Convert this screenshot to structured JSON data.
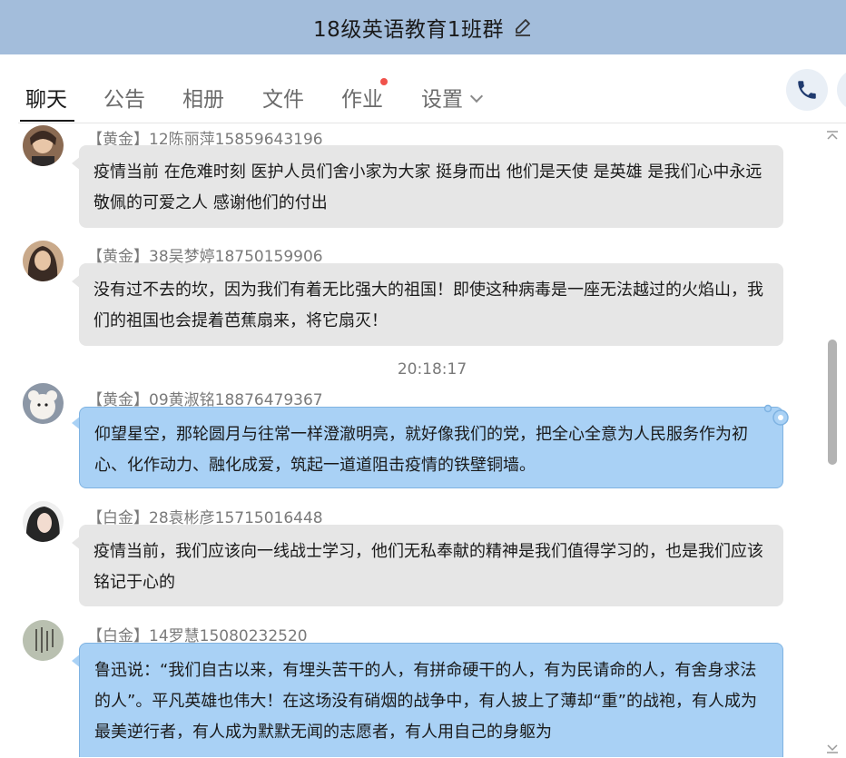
{
  "window": {
    "title": "18级英语教育1班群"
  },
  "tabs": [
    {
      "label": "聊天",
      "active": true
    },
    {
      "label": "公告"
    },
    {
      "label": "相册"
    },
    {
      "label": "文件"
    },
    {
      "label": "作业",
      "has_notification_dot": true
    },
    {
      "label": "设置",
      "has_dropdown": true
    }
  ],
  "icons": {
    "edit": "pencil-icon",
    "call": "phone-icon",
    "scroll_up": "chevron-up-icon",
    "scroll_down": "chevron-down-icon"
  },
  "colors": {
    "titlebar": "#a3bddb",
    "bubble_gray": "#e6e6e6",
    "bubble_blue": "#a9d1f5",
    "notification_dot": "#f0524b",
    "phone_icon": "#1f3a6e"
  },
  "messages": [
    {
      "sender": "【黄金】12陈丽萍15859643196",
      "text": " 疫情当前 在危难时刻 医护人员们舍小家为大家 挺身而出 他们是天使 是英雄 是我们心中永远敬佩的可爱之人 感谢他们的付出",
      "style": "gray"
    },
    {
      "sender": "【黄金】38吴梦婷18750159906",
      "text": "没有过不去的坎，因为我们有着无比强大的祖国！即使这种病毒是一座无法越过的火焰山，我们的祖国也会提着芭蕉扇来，将它扇灭！",
      "style": "gray"
    },
    {
      "sender": "【黄金】09黄淑铭18876479367",
      "text": "仰望星空，那轮圆月与往常一样澄澈明亮，就好像我们的党，把全心全意为人民服务作为初心、化作动力、融化成爱，筑起一道道阻击疫情的铁壁铜墙。",
      "style": "blue"
    },
    {
      "sender": "【白金】28袁彬彦15715016448",
      "text": "疫情当前，我们应该向一线战士学习，他们无私奉献的精神是我们值得学习的，也是我们应该铭记于心的",
      "style": "gray"
    },
    {
      "sender": "【白金】14罗慧15080232520",
      "text": "鲁迅说：“我们自古以来，有埋头苦干的人，有拼命硬干的人，有为民请命的人，有舍身求法的人”。平凡英雄也伟大！在这场没有硝烟的战争中，有人披上了薄却“重”的战袍，有人成为最美逆行者，有人成为默默无闻的志愿者，有人用自己的身躯为",
      "style": "blue"
    }
  ],
  "timestamp": "20:18:17"
}
